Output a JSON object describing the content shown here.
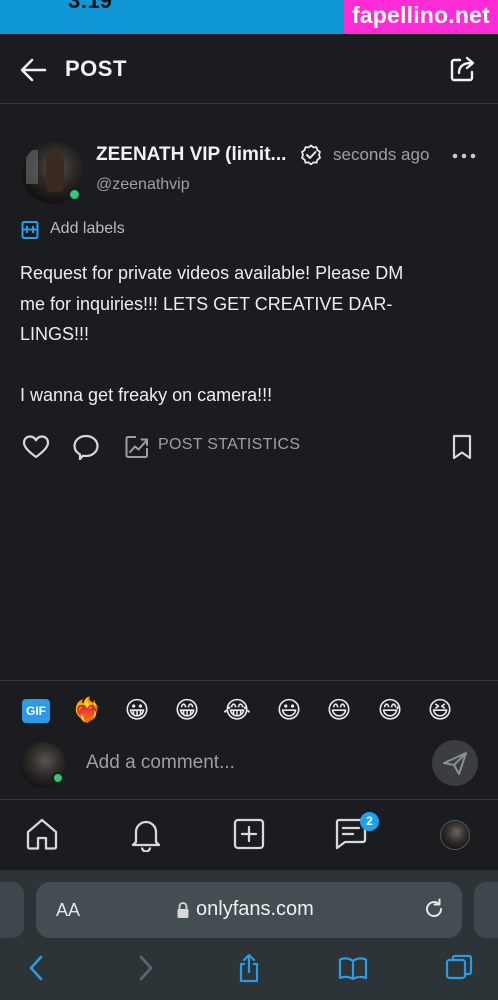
{
  "status": {
    "time": "3:19"
  },
  "watermark": "fapellino.net",
  "header": {
    "title": "POST"
  },
  "post": {
    "author_name": "ZEENATH VIP (limit...",
    "time_ago": "seconds ago",
    "handle": "@zeenathvip",
    "add_labels": "Add labels",
    "text_lines": [
      "Request for private videos available! Please DM",
      "me for inquiries!!! LETS GET CREATIVE DAR-",
      "LINGS!!!",
      "",
      "I wanna get freaky on camera!!!"
    ],
    "post_statistics": "POST STATISTICS"
  },
  "emoji_bar": {
    "gif_label": "GIF",
    "emojis": [
      "❤️‍🔥",
      "😀",
      "😁",
      "😂",
      "😃",
      "😄",
      "😅",
      "😆"
    ]
  },
  "comment": {
    "placeholder": "Add a comment..."
  },
  "nav": {
    "messages_badge": "2"
  },
  "browser": {
    "text_size": "AA",
    "url": "onlyfans.com"
  },
  "colors": {
    "accent": "#1da1f2",
    "online": "#2ecc71",
    "background": "#1b1c1f"
  }
}
